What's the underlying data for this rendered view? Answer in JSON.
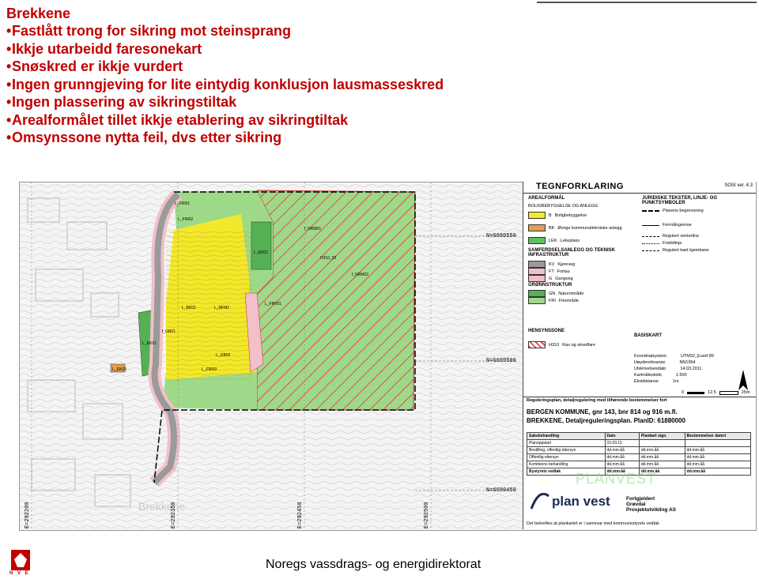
{
  "slide": {
    "title": "Brekkene",
    "bullets": [
      "Fastlått trong for sikring mot steinsprang",
      "Ikkje utarbeidd faresonekart",
      "Snøskred er ikkje vurdert",
      "Ingen grunngjeving for lite eintydig konklusjon lausmasseskred",
      "Ingen plassering av sikringstiltak",
      "Arealformålet tillet ikkje etablering av sikringtiltak",
      "Omsynssone nytta feil, dvs etter sikring"
    ]
  },
  "map": {
    "coordinates_right": [
      "N=6699550",
      "N=6699500",
      "N=6699450"
    ],
    "coordinates_bottom": [
      "E=292200",
      "E=292350",
      "E=292450",
      "E=292500"
    ],
    "plot_labels": [
      "L_FRI01",
      "L_FRI02",
      "L_FRI03",
      "L_EK02",
      "L_EK01",
      "L_EK03",
      "L_BK01",
      "L_NFM1",
      "L_GB02",
      "L_FRV01",
      "f_NRM02",
      "f_NRM01",
      "f_GB01",
      "H310_02"
    ],
    "watermarks": [
      "Brekkene",
      "Brekkene"
    ],
    "map_colors": {
      "yellow": "#f3e82c",
      "green": "#9ed989",
      "dark_green": "#54b254",
      "hatch_red": "#e84a4a",
      "road_gray": "#9a9a9a",
      "road_pink": "#f1c0c8"
    }
  },
  "legend": {
    "title": "TEGNFORKLARING",
    "version": "SOSI ver. 4.3",
    "sections": [
      {
        "title": "AREALFORMÅL",
        "items": [
          {
            "code": "BOLIGBEBYGGELSE OG ANLEGG",
            "color": "#ffffff"
          },
          {
            "code": "B",
            "label": "Boligbebyggelse",
            "color": "#f3e82c"
          },
          {
            "code": "BK",
            "label": "Øvrige kommunaltekniske anlegg",
            "color": "#e0a050"
          },
          {
            "code": "LEK",
            "label": "Lekeplass",
            "color": "#5fbf5f"
          }
        ]
      },
      {
        "title": "SAMFERDSELSANLEGG OG TEKNISK INFRASTRUKTUR",
        "items": [
          {
            "code": "KV",
            "label": "Kjøreveg",
            "color": "#9a9a9a"
          },
          {
            "code": "FT",
            "label": "Fortau",
            "color": "#f1c0c8"
          },
          {
            "code": "G",
            "label": "Gangveg",
            "color": "#f1c0c8"
          }
        ]
      },
      {
        "title": "GRØNNSTRUKTUR",
        "items": [
          {
            "code": "GN",
            "label": "Naturområde",
            "color": "#54b254"
          },
          {
            "code": "FRI",
            "label": "Friområde",
            "color": "#9ed989"
          }
        ]
      },
      {
        "title": "HENSYNSSONE",
        "items": [
          {
            "code": "H310",
            "label": "Ras og skredfare",
            "color": "#e84a4a"
          }
        ]
      }
    ],
    "right_column_title": "JURIDISKE TEKSTER, LINJE- OG PUNKTSYMBOLER",
    "right_items": [
      "Planens begrensning",
      "Formålsgrense",
      "Regulert senterline",
      "Frisiktlinje",
      "Regulert kant kjørebane"
    ],
    "basiskart": {
      "title": "BASISKART",
      "rows": [
        {
          "k": "Koordinatsystem",
          "v": "UTM32_Euref 89"
        },
        {
          "k": "Høydereferanse",
          "v": "NN1954"
        },
        {
          "k": "Utskrivelsesdato",
          "v": "14.03.2011"
        },
        {
          "k": "Kartmålestokk",
          "v": "1:500"
        },
        {
          "k": "Ekvidistanse",
          "v": "1m"
        }
      ]
    },
    "scale_bar": [
      "0",
      "12.5",
      "25m"
    ],
    "plan_heading": "Reguleringsplan, detaljregulering med tilhørende bestemmelser fort",
    "plan_title_line1": "BERGEN KOMMUNE, gnr 143, bnr 814 og 916 m.fl.",
    "plan_title_line2": "BREKKENE, Detaljreguleringsplan. PlanID: 61880000",
    "table_header": [
      "Saksbehandling",
      "Dato",
      "Plankart sign.",
      "Bestemmelser datert"
    ],
    "table_rows": [
      [
        "Planoppstart",
        "15.03.11",
        "",
        ""
      ],
      [
        "Bestilling, offentlig ettersyn",
        "dd.mm.åå",
        "dd.mm.åå",
        "dd.mm.åå"
      ],
      [
        "Offentlig ettersyn",
        "dd.mm.åå",
        "dd.mm.åå",
        "dd.mm.åå"
      ],
      [
        "Komiteens behandling",
        "dd.mm.åå",
        "dd.mm.åå",
        "dd.mm.åå"
      ],
      [
        "Bystyrets vedtak",
        "dd.mm.åå",
        "dd.mm.åå",
        "dd.mm.åå"
      ]
    ],
    "planvest": "plan vest",
    "watermark": "PLANVEST",
    "consultant": [
      "Fortgjeldert",
      "Grøvdal",
      "Prosjektutvikling AS"
    ],
    "footer_note": "Det bekreftes at plankartet er i samsvar med kommunestyrets vedtak"
  },
  "footer": {
    "org": "Noregs vassdrags- og energidirektorat",
    "logo_text": "N V E"
  }
}
